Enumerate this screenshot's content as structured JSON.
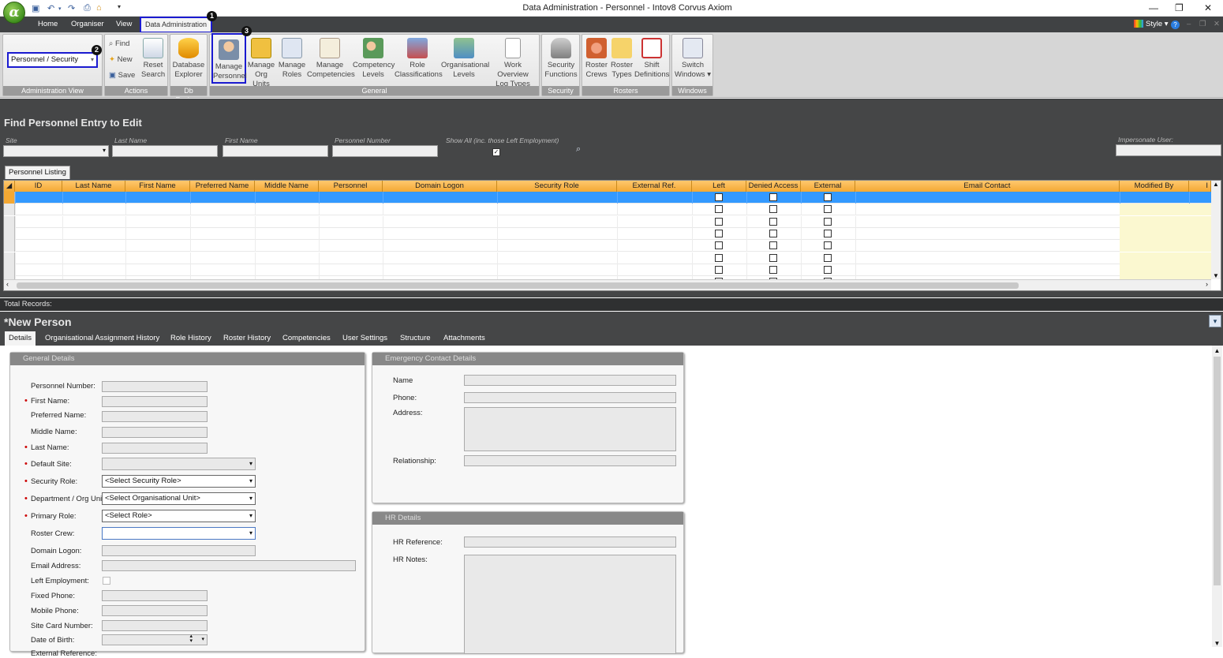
{
  "window": {
    "title": "Data Administration - Personnel - Intov8 Corvus Axiom",
    "style_label": "Style"
  },
  "ribbon_tabs": [
    "Home",
    "Organiser",
    "View",
    "Data Administration"
  ],
  "admin_view": {
    "value": "Personnel / Security",
    "group": "Administration View"
  },
  "actions": {
    "find": "Find",
    "new": "New",
    "save": "Save",
    "reset_line1": "Reset",
    "reset_line2": "Search",
    "group": "Actions"
  },
  "db": {
    "line1": "Database",
    "line2": "Explorer",
    "group": "Db Explorer"
  },
  "general_buttons": [
    {
      "l1": "Manage",
      "l2": "Personnel"
    },
    {
      "l1": "Manage",
      "l2": "Org Units"
    },
    {
      "l1": "Manage",
      "l2": "Roles"
    },
    {
      "l1": "Manage",
      "l2": "Competencies"
    },
    {
      "l1": "Competency",
      "l2": "Levels"
    },
    {
      "l1": "Role",
      "l2": "Classifications"
    },
    {
      "l1": "Organisational",
      "l2": "Levels"
    },
    {
      "l1": "Work Overview",
      "l2": "Log Types"
    }
  ],
  "general_group": "General",
  "security": {
    "l1": "Security",
    "l2": "Functions",
    "group": "Security"
  },
  "rosters": {
    "b1l1": "Roster",
    "b1l2": "Crews",
    "b2l1": "Roster",
    "b2l2": "Types",
    "b3l1": "Shift",
    "b3l2": "Definitions",
    "group": "Rosters"
  },
  "windows": {
    "l1": "Switch",
    "l2": "Windows",
    "group": "Windows"
  },
  "markers": [
    "1",
    "2",
    "3"
  ],
  "find": {
    "title": "Find Personnel Entry to Edit",
    "site": "Site",
    "last_name": "Last Name",
    "first_name": "First Name",
    "personnel_number": "Personnel Number",
    "show_all": "Show All (inc. those Left Employment)",
    "impersonate": "Impersonate User:"
  },
  "listing_tab": "Personnel Listing",
  "columns": [
    "ID",
    "Last Name",
    "First Name",
    "Preferred Name",
    "Middle Name",
    "Personnel",
    "Domain Logon",
    "Security Role",
    "External Ref.",
    "Left",
    "Denied Access",
    "External",
    "Email Contact",
    "Modified By",
    "I"
  ],
  "total_records": "Total Records:",
  "new_person": "*New Person",
  "detail_tabs": [
    "Details",
    "Organisational Assignment History",
    "Role History",
    "Roster History",
    "Competencies",
    "User Settings",
    "Structure",
    "Attachments"
  ],
  "general": {
    "title": "General Details",
    "personnel_number": "Personnel Number:",
    "first_name": "First Name:",
    "preferred_name": "Preferred Name:",
    "middle_name": "Middle Name:",
    "last_name": "Last Name:",
    "default_site": "Default Site:",
    "security_role": "Security Role:",
    "security_role_value": "<Select Security Role>",
    "department": "Department / Org Unit:",
    "department_value": "<Select Organisational Unit>",
    "primary_role": "Primary Role:",
    "primary_role_value": "<Select Role>",
    "roster_crew": "Roster Crew:",
    "domain_logon": "Domain Logon:",
    "email": "Email Address:",
    "left_employment": "Left Employment:",
    "fixed_phone": "Fixed Phone:",
    "mobile_phone": "Mobile Phone:",
    "site_card": "Site Card Number:",
    "dob": "Date of Birth:",
    "external_ref": "External Reference:"
  },
  "emergency": {
    "title": "Emergency Contact Details",
    "name": "Name",
    "phone": "Phone:",
    "address": "Address:",
    "relationship": "Relationship:"
  },
  "hr": {
    "title": "HR Details",
    "reference": "HR Reference:",
    "notes": "HR Notes:"
  }
}
